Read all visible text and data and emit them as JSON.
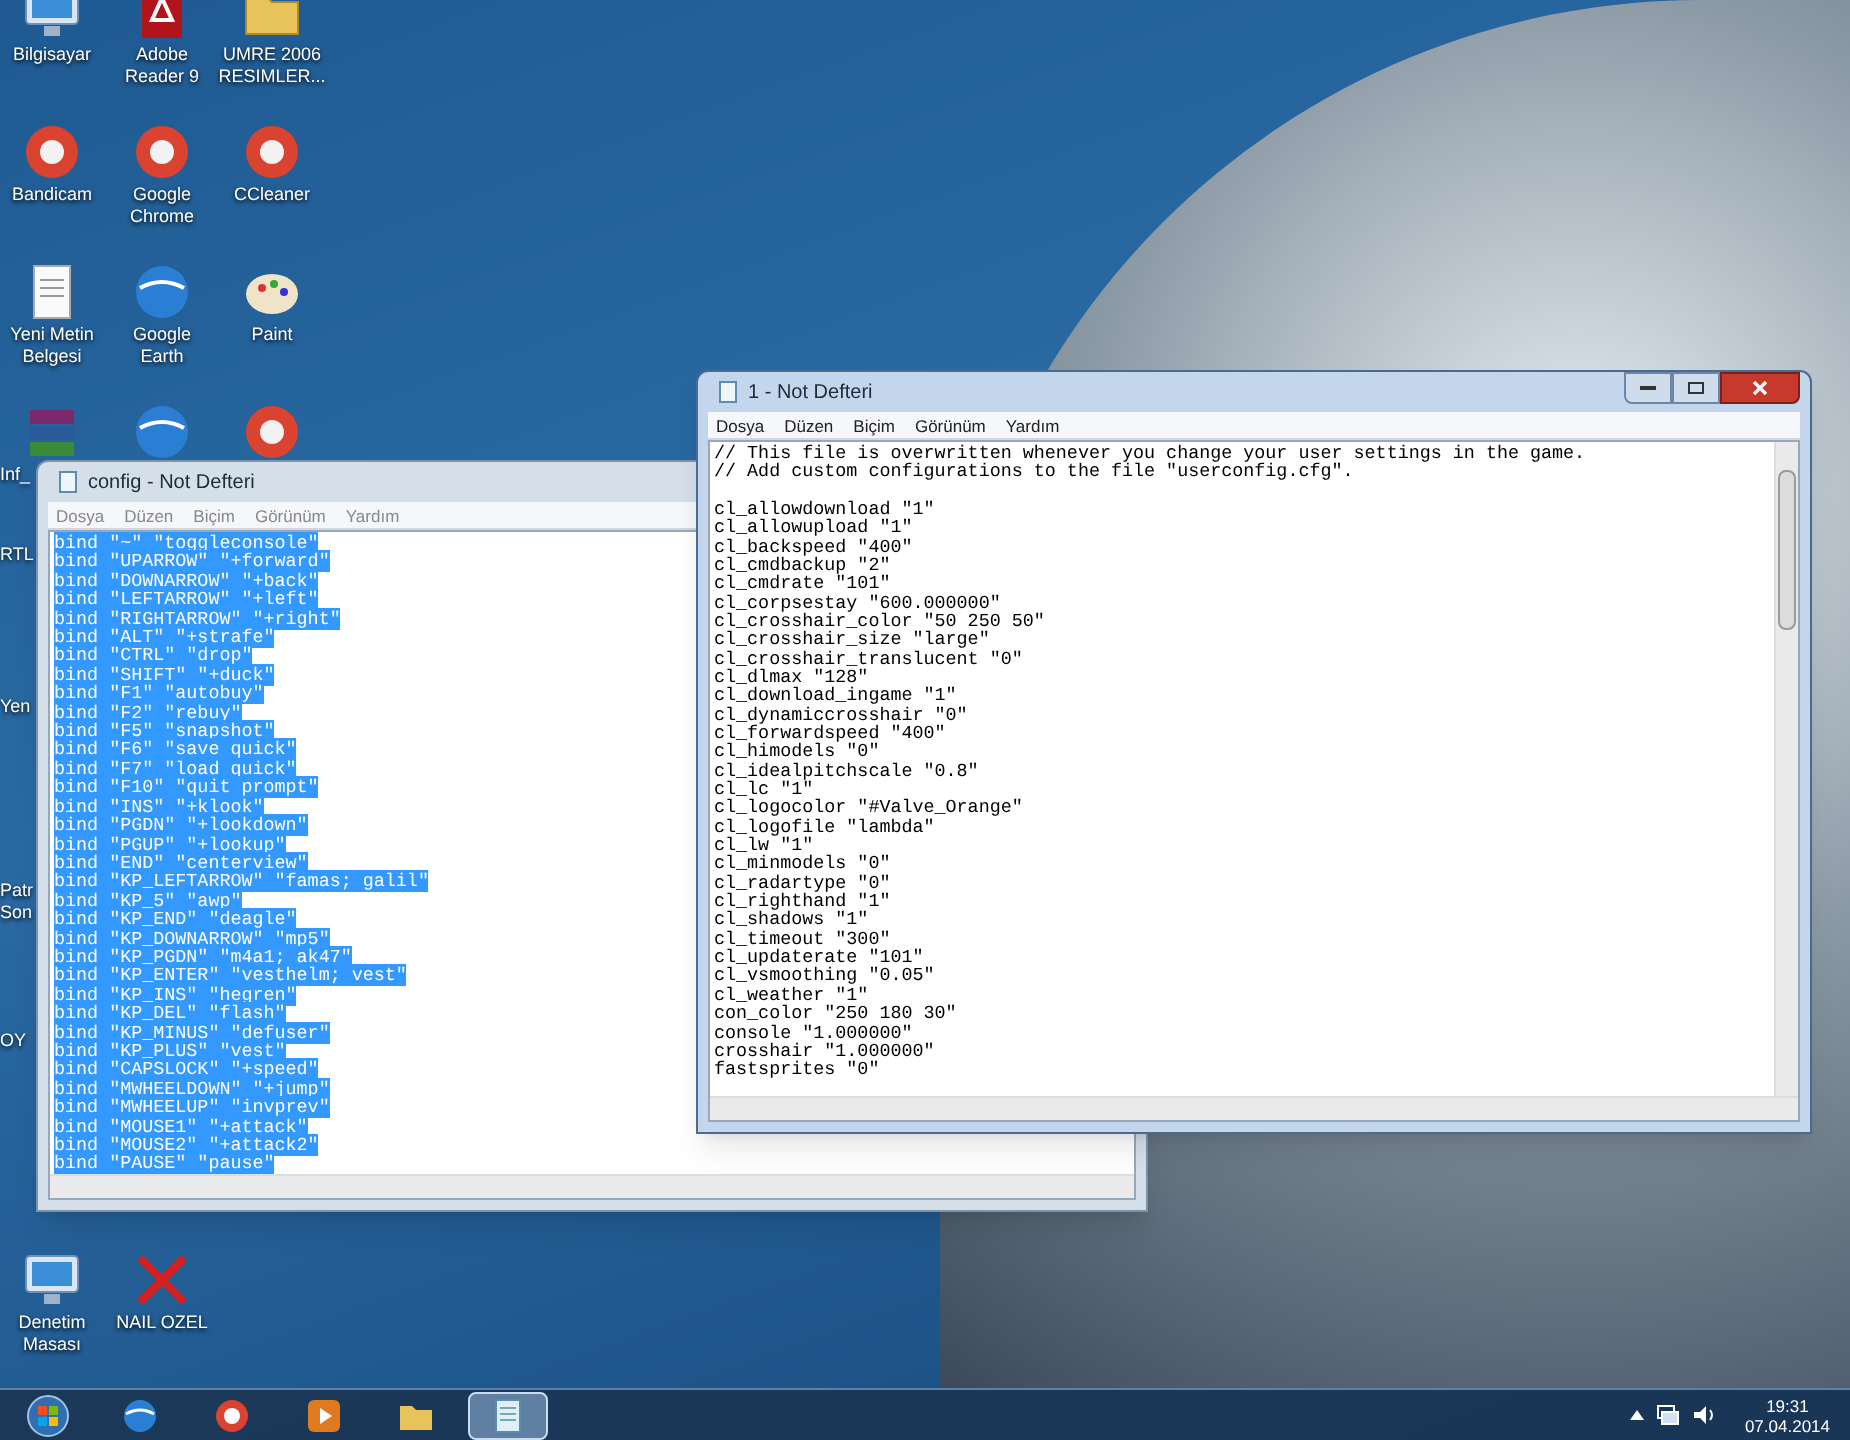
{
  "desktop_icons": [
    {
      "label": "Bilgisayar",
      "kind": "monitor"
    },
    {
      "label": "Adobe Reader 9",
      "kind": "document"
    },
    {
      "label": "UMRE 2006 RESIMLER...",
      "kind": "folder"
    },
    {
      "label": "Bandicam",
      "kind": "circle"
    },
    {
      "label": "Google Chrome",
      "kind": "circle"
    },
    {
      "label": "CCleaner",
      "kind": "circle"
    },
    {
      "label": "Yeni Metin Belgesi",
      "kind": "page"
    },
    {
      "label": "Google Earth",
      "kind": "globe"
    },
    {
      "label": "Paint",
      "kind": "palette"
    },
    {
      "label": "Inf_",
      "kind": "archive"
    },
    {
      "kind": "globe"
    },
    {
      "kind": "circle"
    },
    {
      "label": "RTL",
      "kind": "none"
    },
    {
      "label": "Yen",
      "kind": "none"
    },
    {
      "label": "Patr Son",
      "kind": "none"
    },
    {
      "label": "OY",
      "kind": "none"
    },
    {
      "label": "Denetim Masası",
      "kind": "monitor"
    },
    {
      "label": "NAIL OZEL",
      "kind": "cross"
    }
  ],
  "windows": [
    {
      "title": "config - Not Defteri",
      "active": false,
      "selected": true,
      "menu": [
        "Dosya",
        "Düzen",
        "Biçim",
        "Görünüm",
        "Yardım"
      ],
      "blocks": [
        [
          "bind \"~\" \"toggleconsole\"",
          "bind \"UPARROW\" \"+forward\"",
          "bind \"DOWNARROW\" \"+back\"",
          "bind \"LEFTARROW\" \"+left\"",
          "bind \"RIGHTARROW\" \"+right\"",
          "bind \"ALT\" \"+strafe\"",
          "bind \"CTRL\" \"drop\"",
          "bind \"SHIFT\" \"+duck\"",
          "bind \"F1\" \"autobuy\"",
          "bind \"F2\" \"rebuy\"",
          "bind \"F5\" \"snapshot\"",
          "bind \"F6\" \"save quick\"",
          "bind \"F7\" \"load quick\"",
          "bind \"F10\" \"quit prompt\"",
          "bind \"INS\" \"+klook\"",
          "bind \"PGDN\" \"+lookdown\"",
          "bind \"PGUP\" \"+lookup\"",
          "bind \"END\" \"centerview\"",
          "bind \"KP_LEFTARROW\" \"famas; galil\"",
          "bind \"KP_5\" \"awp\"",
          "bind \"KP_END\" \"deagle\"",
          "bind \"KP_DOWNARROW\" \"mp5\"",
          "bind \"KP_PGDN\" \"m4a1; ak47\"",
          "bind \"KP_ENTER\" \"vesthelm; vest\"",
          "bind \"KP_INS\" \"hegren\"",
          "bind \"KP_DEL\" \"flash\"",
          "bind \"KP_MINUS\" \"defuser\"",
          "bind \"KP_PLUS\" \"vest\"",
          "bind \"CAPSLOCK\" \"+speed\"",
          "bind \"MWHEELDOWN\" \"+jump\"",
          "bind \"MWHEELUP\" \"invprev\"",
          "bind \"MOUSE1\" \"+attack\"",
          "bind \"MOUSE2\" \"+attack2\"",
          "bind \"PAUSE\" \"pause\""
        ]
      ]
    },
    {
      "title": "1 - Not Defteri",
      "active": true,
      "selected": false,
      "menu": [
        "Dosya",
        "Düzen",
        "Biçim",
        "Görünüm",
        "Yardım"
      ],
      "blocks": [
        [
          "// This file is overwritten whenever you change your user settings in the game.",
          "// Add custom configurations to the file \"userconfig.cfg\"."
        ],
        [
          "cl_allowdownload \"1\"",
          "cl_allowupload \"1\"",
          "cl_backspeed \"400\"",
          "cl_cmdbackup \"2\"",
          "cl_cmdrate \"101\"",
          "cl_corpsestay \"600.000000\"",
          "cl_crosshair_color \"50 250 50\"",
          "cl_crosshair_size \"large\"",
          "cl_crosshair_translucent \"0\"",
          "cl_dlmax \"128\"",
          "cl_download_ingame \"1\"",
          "cl_dynamiccrosshair \"0\"",
          "cl_forwardspeed \"400\"",
          "cl_himodels \"0\"",
          "cl_idealpitchscale \"0.8\"",
          "cl_lc \"1\"",
          "cl_logocolor \"#Valve_Orange\"",
          "cl_logofile \"lambda\"",
          "cl_lw \"1\"",
          "cl_minmodels \"0\"",
          "cl_radartype \"0\"",
          "cl_righthand \"1\"",
          "cl_shadows \"1\"",
          "cl_timeout \"300\"",
          "cl_updaterate \"101\"",
          "cl_vsmoothing \"0.05\"",
          "cl_weather \"1\"",
          "con_color \"250 180 30\"",
          "console \"1.000000\"",
          "crosshair \"1.000000\"",
          "fastsprites \"0\""
        ]
      ]
    }
  ],
  "taskbar": {
    "items": [
      {
        "kind": "start",
        "selected": false
      },
      {
        "kind": "globe",
        "selected": false
      },
      {
        "kind": "circle",
        "selected": false
      },
      {
        "kind": "media",
        "selected": false
      },
      {
        "kind": "folder",
        "selected": false
      },
      {
        "kind": "notepad",
        "selected": true
      }
    ],
    "time": "19:31",
    "date": "07.04.2014"
  }
}
